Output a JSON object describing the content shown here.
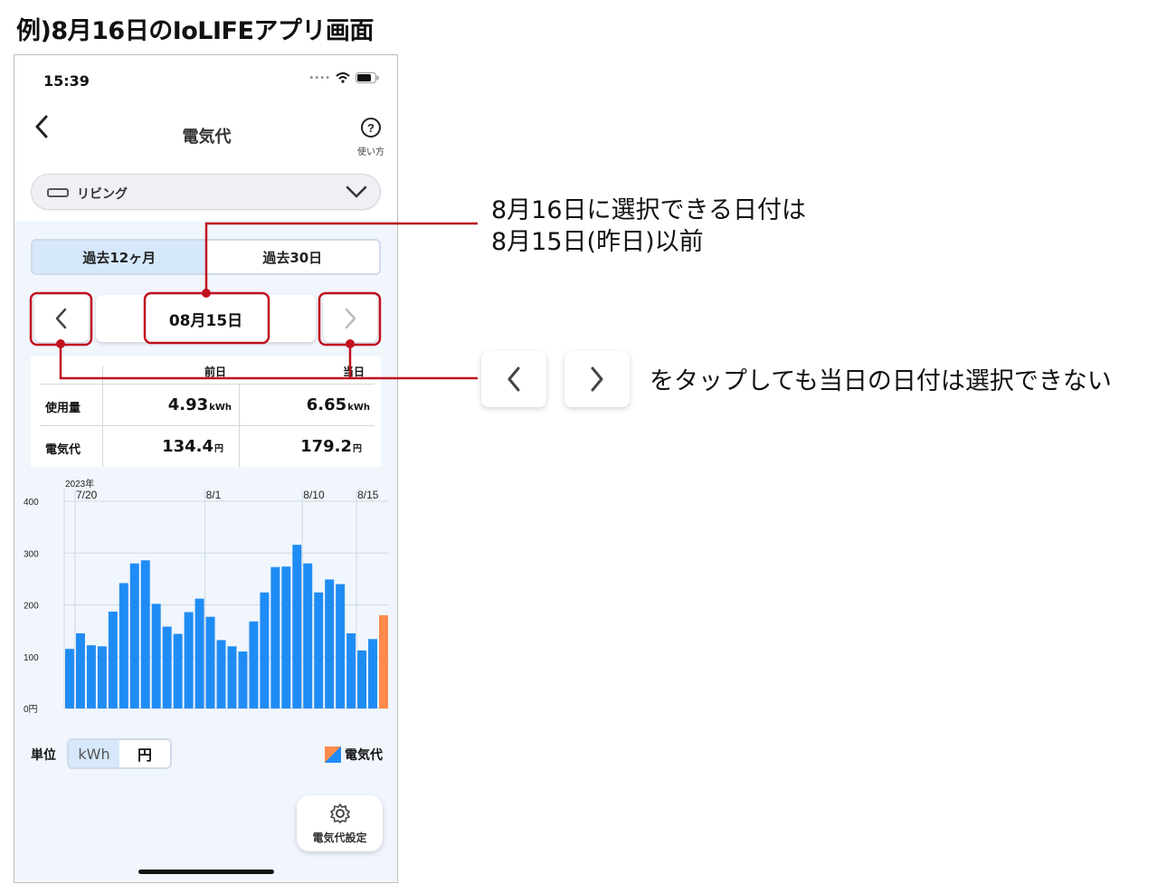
{
  "heading": "例)8月16日のIoLIFEアプリ画面",
  "status": {
    "time": "15:39"
  },
  "nav": {
    "title": "電気代",
    "help_label": "使い方"
  },
  "room": {
    "label": "リビング"
  },
  "period_tabs": [
    {
      "label": "過去12ヶ月",
      "selected": true
    },
    {
      "label": "過去30日",
      "selected": false
    }
  ],
  "date": {
    "value": "08月15日"
  },
  "table": {
    "col_headers": [
      "前日",
      "当日"
    ],
    "rows": [
      {
        "label": "使用量",
        "prev": "4.93",
        "prev_unit": "kWh",
        "today": "6.65",
        "today_unit": "kWh"
      },
      {
        "label": "電気代",
        "prev": "134.4",
        "prev_unit": "円",
        "today": "179.2",
        "today_unit": "円"
      }
    ]
  },
  "chart_data": {
    "type": "bar",
    "year_label": "2023年",
    "x_tick_labels": [
      {
        "label": "7/20",
        "index": 1
      },
      {
        "label": "8/1",
        "index": 13
      },
      {
        "label": "8/10",
        "index": 22
      },
      {
        "label": "8/15",
        "index": 27
      }
    ],
    "y_ticks": [
      "0円",
      "100",
      "200",
      "300",
      "400"
    ],
    "ylim": [
      0,
      400
    ],
    "values": [
      115,
      145,
      122,
      120,
      187,
      242,
      280,
      286,
      202,
      158,
      144,
      186,
      212,
      177,
      132,
      120,
      110,
      168,
      224,
      273,
      274,
      316,
      280,
      224,
      249,
      240,
      145,
      112,
      134,
      180
    ],
    "highlight_last": true,
    "colors": {
      "bar": "#1f8cf5",
      "highlight": "#ff8a4c"
    }
  },
  "unit": {
    "label": "単位",
    "options": [
      "kWh",
      "円"
    ],
    "selected": "kWh"
  },
  "legend": {
    "label": "電気代"
  },
  "setting": {
    "label": "電気代設定"
  },
  "annotations": {
    "line1": "8月16日に選択できる日付は",
    "line2": "8月15日(昨日)以前",
    "tap_note": "をタップしても当日の日付は選択できない"
  },
  "colors": {
    "accent_red": "#c0101f",
    "bar": "#1f8cf5",
    "highlight": "#ff8a4c"
  }
}
